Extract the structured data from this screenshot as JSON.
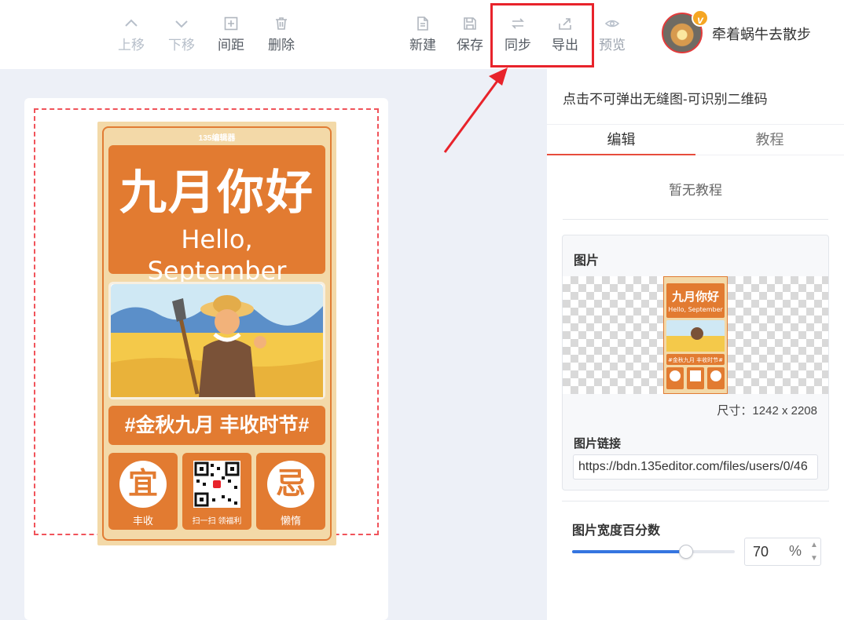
{
  "toolbar": {
    "move_up": "上移",
    "move_down": "下移",
    "spacing": "间距",
    "delete": "删除",
    "new": "新建",
    "save": "保存",
    "sync": "同步",
    "export": "导出",
    "preview": "预览",
    "icons": {
      "move_up": "chevron-up-icon",
      "move_down": "chevron-down-icon",
      "spacing": "plus-square-icon",
      "delete": "trash-icon",
      "new": "document-icon",
      "save": "floppy-disk-icon",
      "sync": "swap-arrows-icon",
      "export": "export-icon",
      "preview": "eye-icon"
    }
  },
  "user": {
    "name": "牵着蜗牛去散步",
    "vip_badge": "v"
  },
  "poster": {
    "brand": "135编辑器",
    "title": "九月你好",
    "subtitle": "Hello, September",
    "slogan": "#金秋九月 丰收时节#",
    "left_tile_char": "宜",
    "left_tile_caption": "丰收",
    "center_tile_caption": "扫一扫 领福利",
    "right_tile_char": "忌",
    "right_tile_caption": "懒惰"
  },
  "panel": {
    "note": "点击不可弹出无缝图-可识别二维码",
    "tabs": [
      "编辑",
      "教程"
    ],
    "active_tab": "编辑",
    "no_tutorial": "暂无教程",
    "image_section_title": "图片",
    "image_size": "尺寸：1242 x 2208",
    "image_link_label": "图片链接",
    "image_link_value": "https://bdn.135editor.com/files/users/0/46",
    "width_percent_label": "图片宽度百分数",
    "width_percent_value": "70",
    "width_percent_unit": "%",
    "width_percent_fraction": 0.7
  },
  "colors": {
    "accent_red": "#e8232b",
    "poster_orange": "#e27b31",
    "poster_cream": "#f3d9a8",
    "slider_blue": "#3575e0"
  }
}
